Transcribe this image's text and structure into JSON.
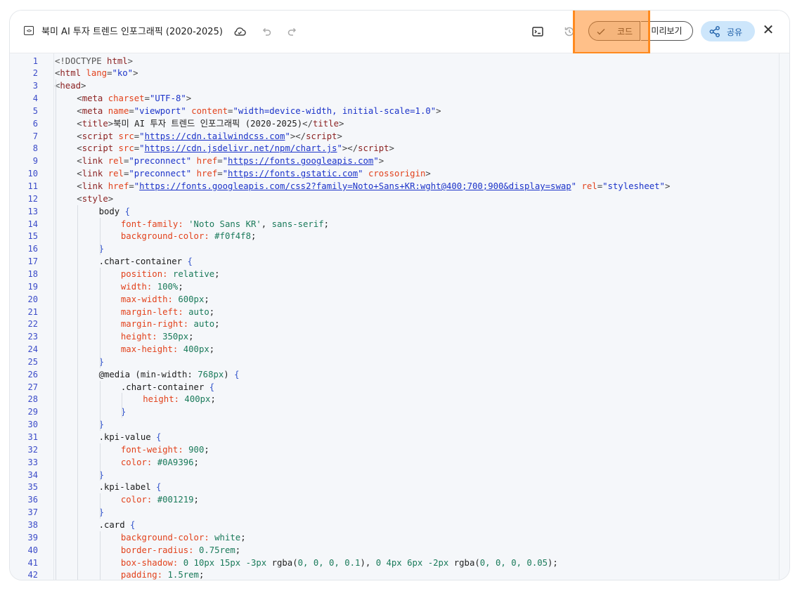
{
  "header": {
    "file_icon": "code-file-icon",
    "title": "북미 AI 투자 트렌드 인포그래픽 (2020-2025)",
    "code_label": "코드",
    "preview_label": "미리보기",
    "share_label": "공유",
    "close_label": "✕",
    "icons": [
      "cloud-sync-icon",
      "undo-icon",
      "redo-icon",
      "terminal-icon",
      "history-icon",
      "check-icon",
      "share-nodes-icon"
    ]
  },
  "colors": {
    "highlight": "#ff8a1f",
    "share_bg": "#cde6fb",
    "line_numbers": "#3b4bc8",
    "editor_bg": "#f5f7fa"
  },
  "editor": {
    "lines": [
      [
        [
          "t-doc",
          "<!DOCTYPE "
        ],
        [
          "t-tag",
          "html"
        ],
        [
          "t-doc",
          ">"
        ]
      ],
      [
        [
          "t-punc",
          "<"
        ],
        [
          "t-tag",
          "html "
        ],
        [
          "t-attr",
          "lang"
        ],
        [
          "t-punc",
          "="
        ],
        [
          "t-str",
          "\"ko\""
        ],
        [
          "t-punc",
          ">"
        ]
      ],
      [
        [
          "t-punc",
          "<"
        ],
        [
          "t-tag",
          "head"
        ],
        [
          "t-punc",
          ">"
        ]
      ],
      [
        [
          "t-punc",
          "<"
        ],
        [
          "t-tag",
          "meta "
        ],
        [
          "t-attr",
          "charset"
        ],
        [
          "t-punc",
          "="
        ],
        [
          "t-str",
          "\"UTF-8\""
        ],
        [
          "t-punc",
          ">"
        ]
      ],
      [
        [
          "t-punc",
          "<"
        ],
        [
          "t-tag",
          "meta "
        ],
        [
          "t-attr",
          "name"
        ],
        [
          "t-punc",
          "="
        ],
        [
          "t-str",
          "\"viewport\" "
        ],
        [
          "t-attr",
          "content"
        ],
        [
          "t-punc",
          "="
        ],
        [
          "t-str",
          "\"width=device-width, initial-scale=1.0\""
        ],
        [
          "t-punc",
          ">"
        ]
      ],
      [
        [
          "t-punc",
          "<"
        ],
        [
          "t-tag",
          "title"
        ],
        [
          "t-punc",
          ">"
        ],
        [
          "t-plain",
          "북미 AI 투자 트렌드 인포그래픽 (2020-2025)"
        ],
        [
          "t-punc",
          "</"
        ],
        [
          "t-tag",
          "title"
        ],
        [
          "t-punc",
          ">"
        ]
      ],
      [
        [
          "t-punc",
          "<"
        ],
        [
          "t-tag",
          "script "
        ],
        [
          "t-attr",
          "src"
        ],
        [
          "t-punc",
          "="
        ],
        [
          "t-str",
          "\""
        ],
        [
          "t-link",
          "https://cdn.tailwindcss.com"
        ],
        [
          "t-str",
          "\""
        ],
        [
          "t-punc",
          "></"
        ],
        [
          "t-tag",
          "script"
        ],
        [
          "t-punc",
          ">"
        ]
      ],
      [
        [
          "t-punc",
          "<"
        ],
        [
          "t-tag",
          "script "
        ],
        [
          "t-attr",
          "src"
        ],
        [
          "t-punc",
          "="
        ],
        [
          "t-str",
          "\""
        ],
        [
          "t-link",
          "https://cdn.jsdelivr.net/npm/chart.js"
        ],
        [
          "t-str",
          "\""
        ],
        [
          "t-punc",
          "></"
        ],
        [
          "t-tag",
          "script"
        ],
        [
          "t-punc",
          ">"
        ]
      ],
      [
        [
          "t-punc",
          "<"
        ],
        [
          "t-tag",
          "link "
        ],
        [
          "t-attr",
          "rel"
        ],
        [
          "t-punc",
          "="
        ],
        [
          "t-str",
          "\"preconnect\" "
        ],
        [
          "t-attr",
          "href"
        ],
        [
          "t-punc",
          "="
        ],
        [
          "t-str",
          "\""
        ],
        [
          "t-link",
          "https://fonts.googleapis.com"
        ],
        [
          "t-str",
          "\""
        ],
        [
          "t-punc",
          ">"
        ]
      ],
      [
        [
          "t-punc",
          "<"
        ],
        [
          "t-tag",
          "link "
        ],
        [
          "t-attr",
          "rel"
        ],
        [
          "t-punc",
          "="
        ],
        [
          "t-str",
          "\"preconnect\" "
        ],
        [
          "t-attr",
          "href"
        ],
        [
          "t-punc",
          "="
        ],
        [
          "t-str",
          "\""
        ],
        [
          "t-link",
          "https://fonts.gstatic.com"
        ],
        [
          "t-str",
          "\" "
        ],
        [
          "t-attr",
          "crossorigin"
        ],
        [
          "t-punc",
          ">"
        ]
      ],
      [
        [
          "t-punc",
          "<"
        ],
        [
          "t-tag",
          "link "
        ],
        [
          "t-attr",
          "href"
        ],
        [
          "t-punc",
          "="
        ],
        [
          "t-str",
          "\""
        ],
        [
          "t-link",
          "https://fonts.googleapis.com/css2?family=Noto+Sans+KR:wght@400;700;900&display=swap"
        ],
        [
          "t-str",
          "\" "
        ],
        [
          "t-attr",
          "rel"
        ],
        [
          "t-punc",
          "="
        ],
        [
          "t-str",
          "\"stylesheet\""
        ],
        [
          "t-punc",
          ">"
        ]
      ],
      [
        [
          "t-punc",
          "<"
        ],
        [
          "t-tag",
          "style"
        ],
        [
          "t-punc",
          ">"
        ]
      ],
      [
        [
          "t-sel",
          "body "
        ],
        [
          "t-brace",
          "{"
        ]
      ],
      [
        [
          "t-prop",
          "font-family: "
        ],
        [
          "t-val",
          "'Noto Sans KR'"
        ],
        [
          "t-plain",
          ", "
        ],
        [
          "t-val",
          "sans-serif"
        ],
        [
          "t-plain",
          ";"
        ]
      ],
      [
        [
          "t-prop",
          "background-color: "
        ],
        [
          "t-val",
          "#f0f4f8"
        ],
        [
          "t-plain",
          ";"
        ]
      ],
      [
        [
          "t-brace",
          "}"
        ]
      ],
      [
        [
          "t-sel",
          ".chart-container "
        ],
        [
          "t-brace",
          "{"
        ]
      ],
      [
        [
          "t-prop",
          "position: "
        ],
        [
          "t-val",
          "relative"
        ],
        [
          "t-plain",
          ";"
        ]
      ],
      [
        [
          "t-prop",
          "width: "
        ],
        [
          "t-num",
          "100%"
        ],
        [
          "t-plain",
          ";"
        ]
      ],
      [
        [
          "t-prop",
          "max-width: "
        ],
        [
          "t-num",
          "600px"
        ],
        [
          "t-plain",
          ";"
        ]
      ],
      [
        [
          "t-prop",
          "margin-left: "
        ],
        [
          "t-val",
          "auto"
        ],
        [
          "t-plain",
          ";"
        ]
      ],
      [
        [
          "t-prop",
          "margin-right: "
        ],
        [
          "t-val",
          "auto"
        ],
        [
          "t-plain",
          ";"
        ]
      ],
      [
        [
          "t-prop",
          "height: "
        ],
        [
          "t-num",
          "350px"
        ],
        [
          "t-plain",
          ";"
        ]
      ],
      [
        [
          "t-prop",
          "max-height: "
        ],
        [
          "t-num",
          "400px"
        ],
        [
          "t-plain",
          ";"
        ]
      ],
      [
        [
          "t-brace",
          "}"
        ]
      ],
      [
        [
          "t-sel",
          "@media "
        ],
        [
          "t-plain",
          "(min-width: "
        ],
        [
          "t-num",
          "768px"
        ],
        [
          "t-plain",
          ") "
        ],
        [
          "t-brace",
          "{"
        ]
      ],
      [
        [
          "t-sel",
          ".chart-container "
        ],
        [
          "t-brace",
          "{"
        ]
      ],
      [
        [
          "t-prop",
          "height: "
        ],
        [
          "t-num",
          "400px"
        ],
        [
          "t-plain",
          ";"
        ]
      ],
      [
        [
          "t-brace",
          "}"
        ]
      ],
      [
        [
          "t-brace",
          "}"
        ]
      ],
      [
        [
          "t-sel",
          ".kpi-value "
        ],
        [
          "t-brace",
          "{"
        ]
      ],
      [
        [
          "t-prop",
          "font-weight: "
        ],
        [
          "t-num",
          "900"
        ],
        [
          "t-plain",
          ";"
        ]
      ],
      [
        [
          "t-prop",
          "color: "
        ],
        [
          "t-val",
          "#0A9396"
        ],
        [
          "t-plain",
          ";"
        ]
      ],
      [
        [
          "t-brace",
          "}"
        ]
      ],
      [
        [
          "t-sel",
          ".kpi-label "
        ],
        [
          "t-brace",
          "{"
        ]
      ],
      [
        [
          "t-prop",
          "color: "
        ],
        [
          "t-val",
          "#001219"
        ],
        [
          "t-plain",
          ";"
        ]
      ],
      [
        [
          "t-brace",
          "}"
        ]
      ],
      [
        [
          "t-sel",
          ".card "
        ],
        [
          "t-brace",
          "{"
        ]
      ],
      [
        [
          "t-prop",
          "background-color: "
        ],
        [
          "t-val",
          "white"
        ],
        [
          "t-plain",
          ";"
        ]
      ],
      [
        [
          "t-prop",
          "border-radius: "
        ],
        [
          "t-num",
          "0.75rem"
        ],
        [
          "t-plain",
          ";"
        ]
      ],
      [
        [
          "t-prop",
          "box-shadow: "
        ],
        [
          "t-num",
          "0 10px 15px -3px "
        ],
        [
          "t-plain",
          "rgba("
        ],
        [
          "t-num",
          "0, 0, 0, 0.1"
        ],
        [
          "t-plain",
          "), "
        ],
        [
          "t-num",
          "0 4px 6px -2px "
        ],
        [
          "t-plain",
          "rgba("
        ],
        [
          "t-num",
          "0, 0, 0, 0.05"
        ],
        [
          "t-plain",
          ");"
        ]
      ],
      [
        [
          "t-prop",
          "padding: "
        ],
        [
          "t-num",
          "1.5rem"
        ],
        [
          "t-plain",
          ";"
        ]
      ]
    ]
  }
}
